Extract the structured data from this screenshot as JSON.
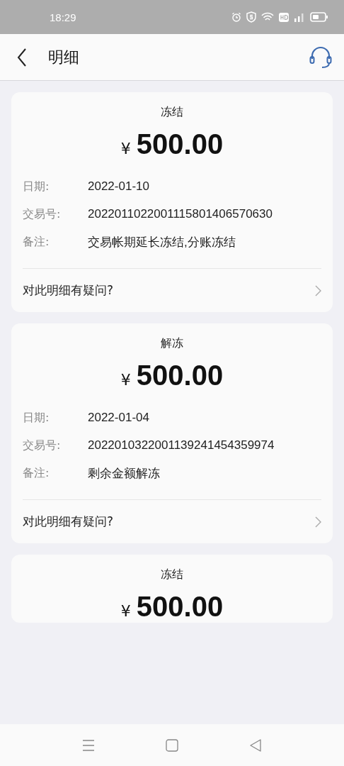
{
  "status_bar": {
    "time": "18:29"
  },
  "header": {
    "title": "明细"
  },
  "records": [
    {
      "status": "冻结",
      "currency": "¥",
      "amount": "500.00",
      "fields": [
        {
          "label": "日期:",
          "value": "2022-01-10"
        },
        {
          "label": "交易号:",
          "value": "2022011022001115801406570630"
        },
        {
          "label": "备注:",
          "value": "交易帐期延长冻结,分账冻结"
        }
      ],
      "question": "对此明细有疑问?"
    },
    {
      "status": "解冻",
      "currency": "¥",
      "amount": "500.00",
      "fields": [
        {
          "label": "日期:",
          "value": "2022-01-04"
        },
        {
          "label": "交易号:",
          "value": "2022010322001139241454359974"
        },
        {
          "label": "备注:",
          "value": "剩余金额解冻"
        }
      ],
      "question": "对此明细有疑问?"
    },
    {
      "status": "冻结",
      "currency": "¥",
      "amount": "500.00"
    }
  ]
}
